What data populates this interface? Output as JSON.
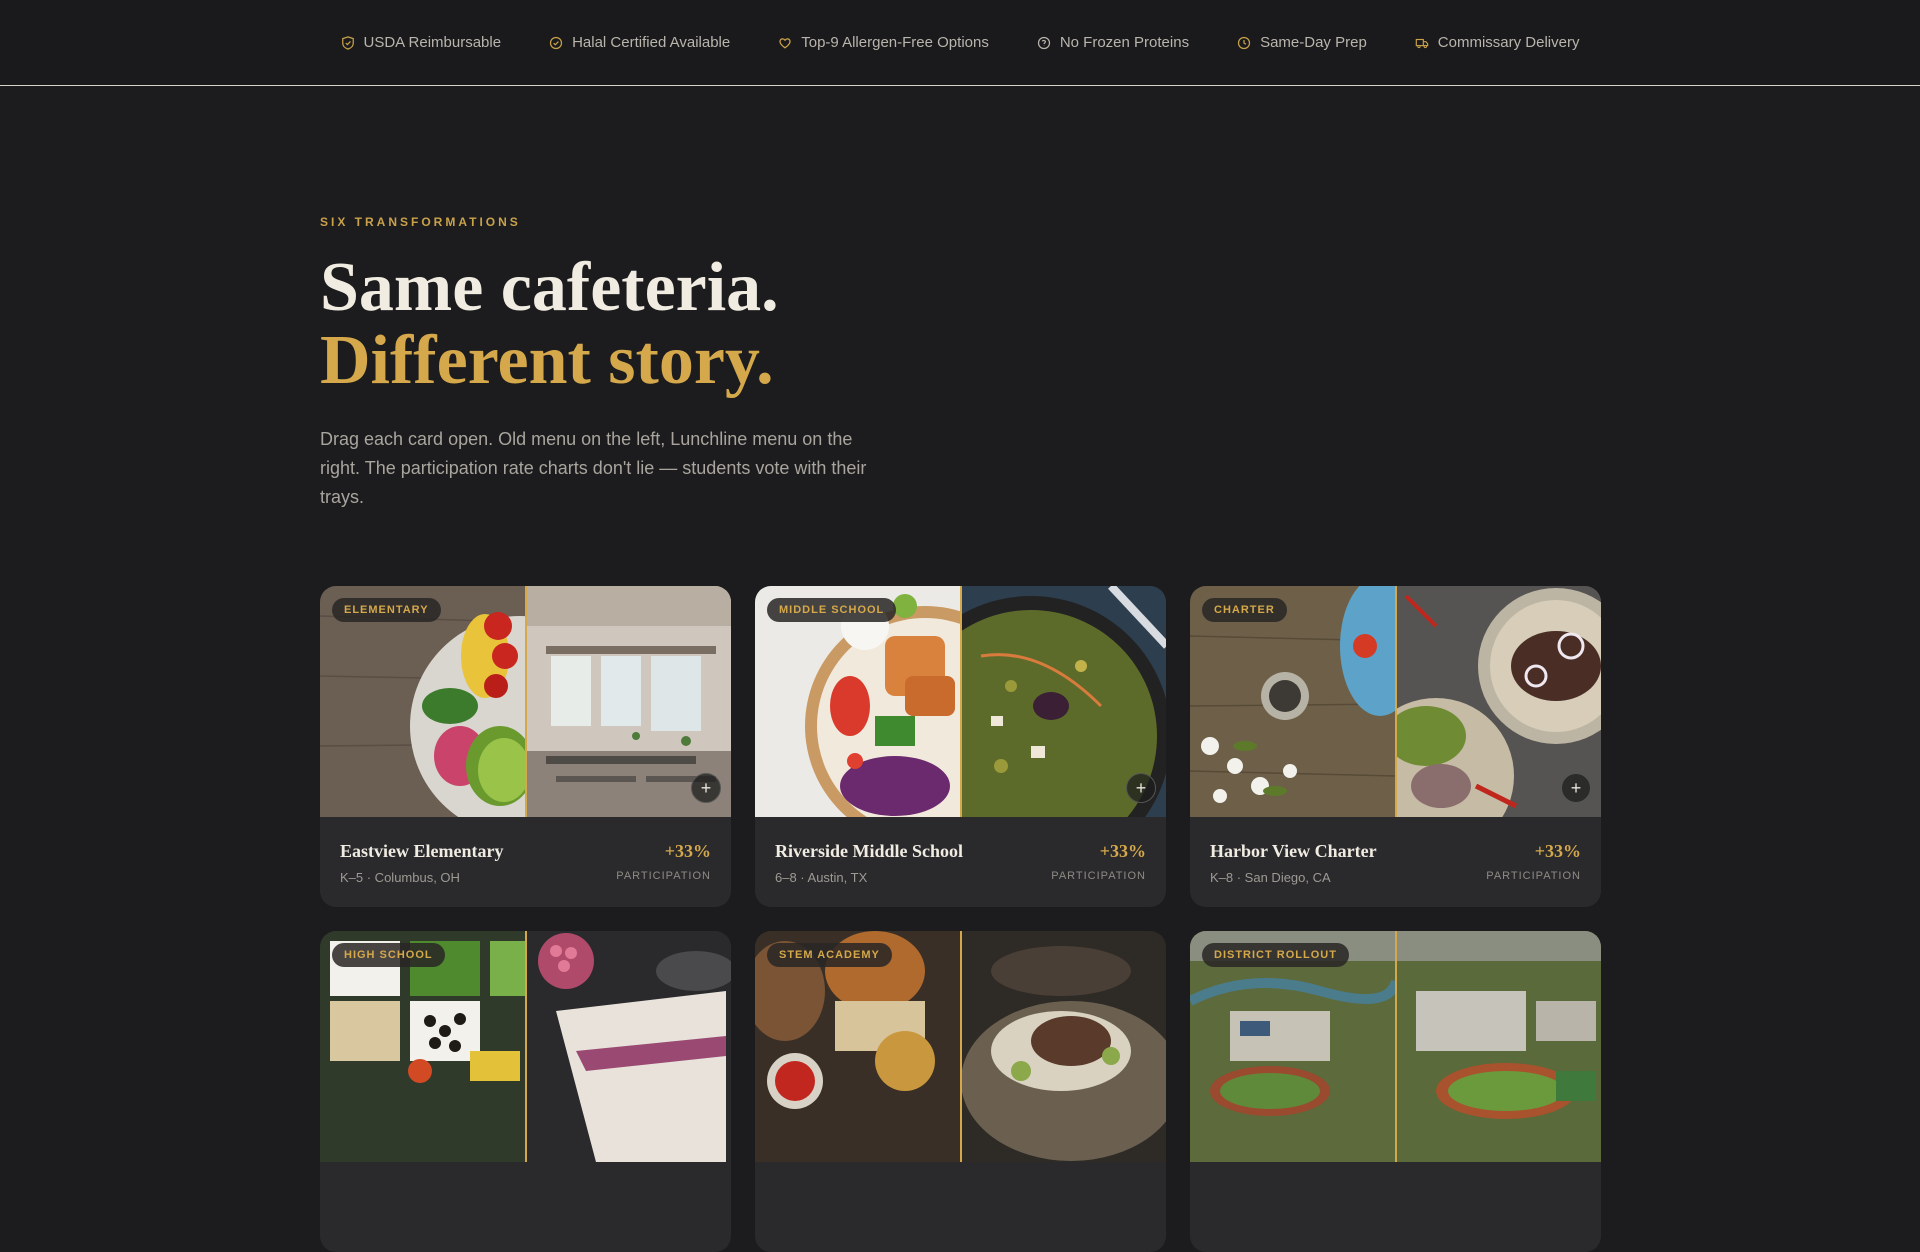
{
  "trust_bar": {
    "items": [
      {
        "label": "USDA Reimbursable",
        "icon": "shield-icon"
      },
      {
        "label": "Halal Certified Available",
        "icon": "check-badge-icon"
      },
      {
        "label": "Top-9 Allergen-Free Options",
        "icon": "heart-icon"
      },
      {
        "label": "No Frozen Proteins",
        "icon": "snowflake-off-icon"
      },
      {
        "label": "Same-Day Prep",
        "icon": "clock-icon"
      },
      {
        "label": "Commissary Delivery",
        "icon": "truck-icon"
      }
    ]
  },
  "hero": {
    "eyebrow": "SIX TRANSFORMATIONS",
    "title_line1": "Same cafeteria.",
    "title_line2": "Different story.",
    "lede": "Drag each card open. Old menu on the left, Lunchline menu on the right. The participation rate charts don't lie — students vote with their trays."
  },
  "cards": [
    {
      "tag": "ELEMENTARY",
      "name": "Eastview Elementary",
      "meta": "K–5 · Columbus, OH",
      "stat": "+33%",
      "stat_label": "PARTICIPATION"
    },
    {
      "tag": "MIDDLE SCHOOL",
      "name": "Riverside Middle School",
      "meta": "6–8 · Austin, TX",
      "stat": "+33%",
      "stat_label": "PARTICIPATION"
    },
    {
      "tag": "CHARTER",
      "name": "Harbor View Charter",
      "meta": "K–8 · San Diego, CA",
      "stat": "+33%",
      "stat_label": "PARTICIPATION"
    },
    {
      "tag": "HIGH SCHOOL"
    },
    {
      "tag": "STEM ACADEMY"
    },
    {
      "tag": "DISTRICT ROLLOUT"
    }
  ],
  "colors": {
    "accent": "#d4a84b",
    "background": "#1c1c1e",
    "card": "#2a2a2d"
  }
}
